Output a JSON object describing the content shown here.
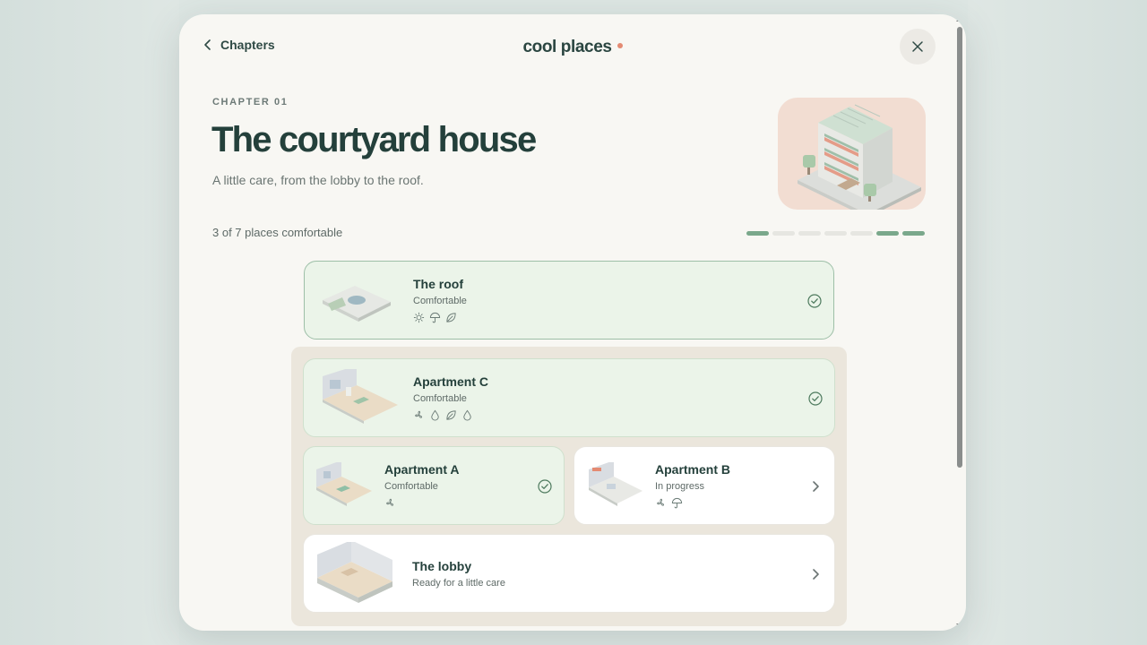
{
  "header": {
    "back_label": "Chapters",
    "brand": "cool places",
    "close_label": "Close"
  },
  "chapter": {
    "label": "CHAPTER 01",
    "title": "The courtyard house",
    "subtitle": "A little care, from the lobby to the roof.",
    "progress_text": "3 of 7 places comfortable",
    "progress": {
      "total": 7,
      "segments": [
        true,
        false,
        false,
        false,
        false,
        true,
        true
      ]
    }
  },
  "places": {
    "roof": {
      "name": "The roof",
      "status": "Comfortable",
      "icons": [
        "sun-icon",
        "umbrella-icon",
        "leaf-icon"
      ]
    },
    "apt_c": {
      "name": "Apartment C",
      "status": "Comfortable",
      "icons": [
        "fan-icon",
        "drop-icon",
        "leaf-icon",
        "drop-icon"
      ]
    },
    "apt_a": {
      "name": "Apartment A",
      "status": "Comfortable",
      "icons": [
        "fan-icon"
      ]
    },
    "apt_b": {
      "name": "Apartment B",
      "status": "In progress",
      "icons": [
        "fan-icon",
        "umbrella-icon"
      ]
    },
    "lobby": {
      "name": "The lobby",
      "status": "Ready for a little care"
    }
  },
  "colors": {
    "accent_green": "#7aa88b",
    "brand_dot": "#e48a72",
    "done_card": "#ebf4e9",
    "title_text": "#24403b"
  }
}
